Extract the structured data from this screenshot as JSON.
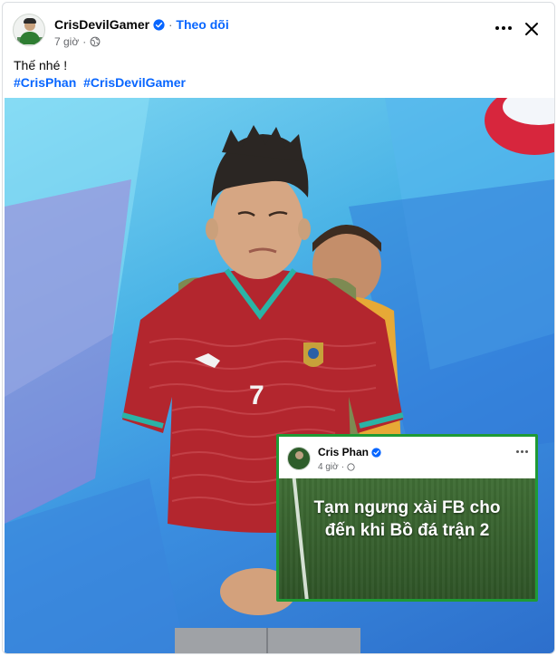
{
  "post": {
    "author": "CrisDevilGamer",
    "follow_label": "Theo dõi",
    "timestamp": "7 giờ",
    "caption": "Thế nhé !",
    "hashtags": [
      "#CrisPhan",
      "#CrisDevilGamer"
    ]
  },
  "embedded_post": {
    "author": "Cris Phan",
    "timestamp": "4 giờ",
    "text_line1": "Tạm ngưng xài FB cho",
    "text_line2": "đến khi Bồ đá trận 2"
  },
  "photo": {
    "jersey_number": "7"
  },
  "colors": {
    "link_blue": "#0866ff",
    "verified_blue": "#0866ff",
    "inset_border": "#1f9a35",
    "jersey_red": "#b3262e"
  },
  "icons": [
    "verified-badge-icon",
    "globe-icon",
    "more-options-icon",
    "close-icon"
  ]
}
